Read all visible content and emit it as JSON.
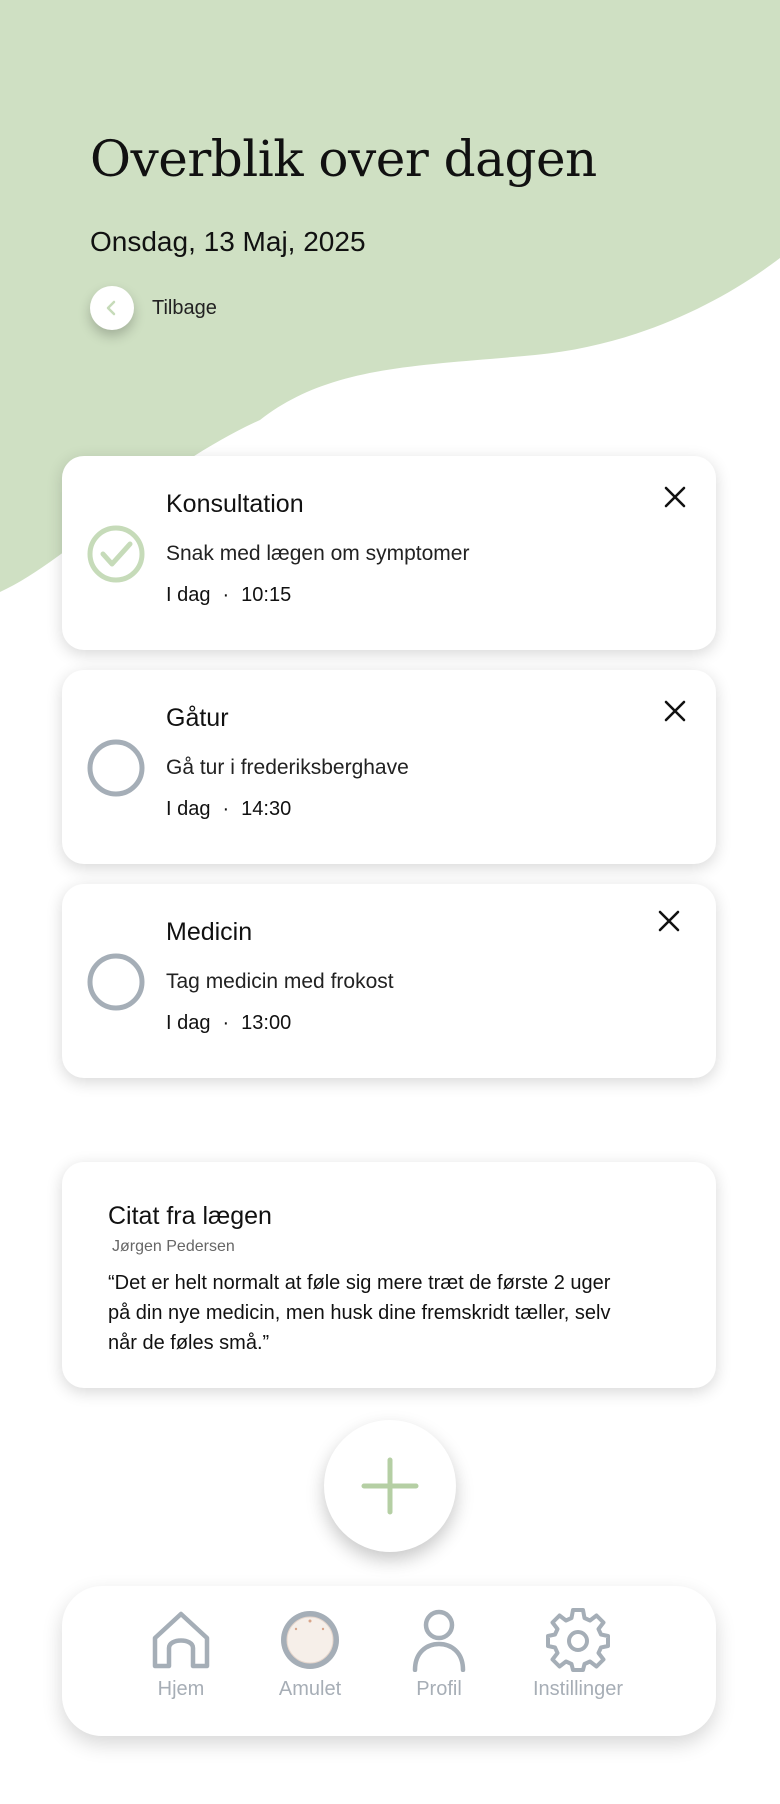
{
  "header": {
    "title": "Overblik over dagen",
    "date": "Onsdag, 13 Maj, 2025",
    "back_label": "Tilbage"
  },
  "tasks": [
    {
      "title": "Konsultation",
      "description": "Snak med lægen om symptomer",
      "day": "I dag",
      "separator": "·",
      "time": "10:15",
      "completed": true
    },
    {
      "title": "Gåtur",
      "description": "Gå tur i frederiksberghave",
      "day": "I dag",
      "separator": "·",
      "time": "14:30",
      "completed": false
    },
    {
      "title": "Medicin",
      "description": "Tag medicin med frokost",
      "day": "I dag",
      "separator": "·",
      "time": "13:00",
      "completed": false
    }
  ],
  "quote": {
    "title": "Citat fra lægen",
    "author": "Jørgen Pedersen",
    "text": "“Det er helt normalt at føle sig mere træt de første 2 uger på din nye medicin, men husk dine fremskridt tæller, selv når de føles små.”"
  },
  "fab": {
    "icon": "plus-icon"
  },
  "nav": {
    "items": [
      {
        "label": "Hjem",
        "icon": "home-icon"
      },
      {
        "label": "Amulet",
        "icon": "amulet-icon"
      },
      {
        "label": "Profil",
        "icon": "person-icon"
      },
      {
        "label": "Instillinger",
        "icon": "gear-icon"
      }
    ]
  },
  "colors": {
    "accent_green": "#cfe0c3",
    "check_green": "#c6dbb9",
    "plus_green": "#b5cfa4",
    "inactive_gray": "#a5aeb7",
    "nav_label_gray": "#a7aeb6"
  }
}
